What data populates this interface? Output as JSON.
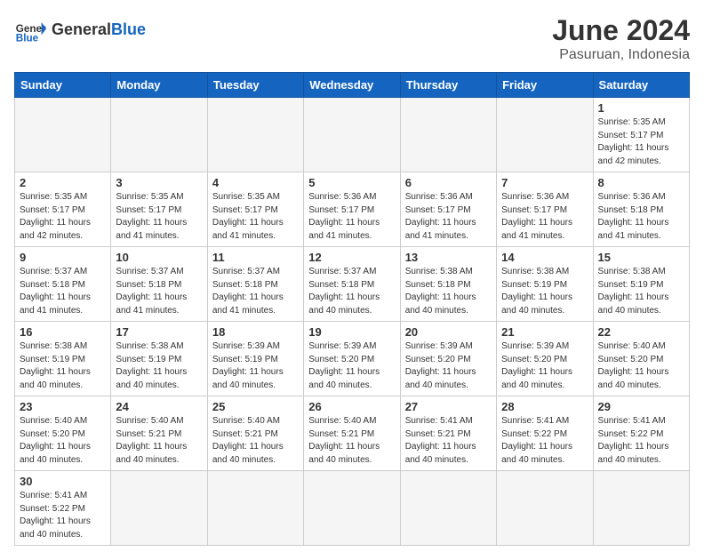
{
  "header": {
    "logo_general": "General",
    "logo_blue": "Blue",
    "month": "June 2024",
    "location": "Pasuruan, Indonesia"
  },
  "weekdays": [
    "Sunday",
    "Monday",
    "Tuesday",
    "Wednesday",
    "Thursday",
    "Friday",
    "Saturday"
  ],
  "days": {
    "1": {
      "sunrise": "5:35 AM",
      "sunset": "5:17 PM",
      "daylight": "11 hours and 42 minutes."
    },
    "2": {
      "sunrise": "5:35 AM",
      "sunset": "5:17 PM",
      "daylight": "11 hours and 42 minutes."
    },
    "3": {
      "sunrise": "5:35 AM",
      "sunset": "5:17 PM",
      "daylight": "11 hours and 41 minutes."
    },
    "4": {
      "sunrise": "5:35 AM",
      "sunset": "5:17 PM",
      "daylight": "11 hours and 41 minutes."
    },
    "5": {
      "sunrise": "5:36 AM",
      "sunset": "5:17 PM",
      "daylight": "11 hours and 41 minutes."
    },
    "6": {
      "sunrise": "5:36 AM",
      "sunset": "5:17 PM",
      "daylight": "11 hours and 41 minutes."
    },
    "7": {
      "sunrise": "5:36 AM",
      "sunset": "5:17 PM",
      "daylight": "11 hours and 41 minutes."
    },
    "8": {
      "sunrise": "5:36 AM",
      "sunset": "5:18 PM",
      "daylight": "11 hours and 41 minutes."
    },
    "9": {
      "sunrise": "5:37 AM",
      "sunset": "5:18 PM",
      "daylight": "11 hours and 41 minutes."
    },
    "10": {
      "sunrise": "5:37 AM",
      "sunset": "5:18 PM",
      "daylight": "11 hours and 41 minutes."
    },
    "11": {
      "sunrise": "5:37 AM",
      "sunset": "5:18 PM",
      "daylight": "11 hours and 41 minutes."
    },
    "12": {
      "sunrise": "5:37 AM",
      "sunset": "5:18 PM",
      "daylight": "11 hours and 40 minutes."
    },
    "13": {
      "sunrise": "5:38 AM",
      "sunset": "5:18 PM",
      "daylight": "11 hours and 40 minutes."
    },
    "14": {
      "sunrise": "5:38 AM",
      "sunset": "5:19 PM",
      "daylight": "11 hours and 40 minutes."
    },
    "15": {
      "sunrise": "5:38 AM",
      "sunset": "5:19 PM",
      "daylight": "11 hours and 40 minutes."
    },
    "16": {
      "sunrise": "5:38 AM",
      "sunset": "5:19 PM",
      "daylight": "11 hours and 40 minutes."
    },
    "17": {
      "sunrise": "5:38 AM",
      "sunset": "5:19 PM",
      "daylight": "11 hours and 40 minutes."
    },
    "18": {
      "sunrise": "5:39 AM",
      "sunset": "5:19 PM",
      "daylight": "11 hours and 40 minutes."
    },
    "19": {
      "sunrise": "5:39 AM",
      "sunset": "5:20 PM",
      "daylight": "11 hours and 40 minutes."
    },
    "20": {
      "sunrise": "5:39 AM",
      "sunset": "5:20 PM",
      "daylight": "11 hours and 40 minutes."
    },
    "21": {
      "sunrise": "5:39 AM",
      "sunset": "5:20 PM",
      "daylight": "11 hours and 40 minutes."
    },
    "22": {
      "sunrise": "5:40 AM",
      "sunset": "5:20 PM",
      "daylight": "11 hours and 40 minutes."
    },
    "23": {
      "sunrise": "5:40 AM",
      "sunset": "5:20 PM",
      "daylight": "11 hours and 40 minutes."
    },
    "24": {
      "sunrise": "5:40 AM",
      "sunset": "5:21 PM",
      "daylight": "11 hours and 40 minutes."
    },
    "25": {
      "sunrise": "5:40 AM",
      "sunset": "5:21 PM",
      "daylight": "11 hours and 40 minutes."
    },
    "26": {
      "sunrise": "5:40 AM",
      "sunset": "5:21 PM",
      "daylight": "11 hours and 40 minutes."
    },
    "27": {
      "sunrise": "5:41 AM",
      "sunset": "5:21 PM",
      "daylight": "11 hours and 40 minutes."
    },
    "28": {
      "sunrise": "5:41 AM",
      "sunset": "5:22 PM",
      "daylight": "11 hours and 40 minutes."
    },
    "29": {
      "sunrise": "5:41 AM",
      "sunset": "5:22 PM",
      "daylight": "11 hours and 40 minutes."
    },
    "30": {
      "sunrise": "5:41 AM",
      "sunset": "5:22 PM",
      "daylight": "11 hours and 40 minutes."
    }
  }
}
